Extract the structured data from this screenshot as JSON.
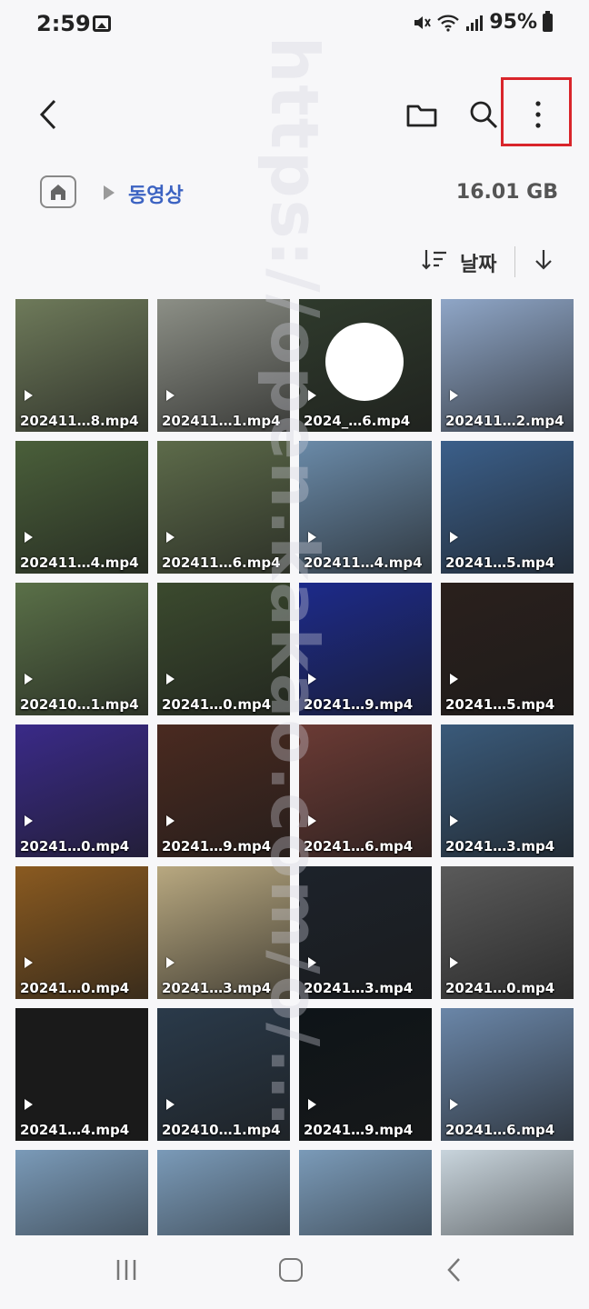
{
  "status_bar": {
    "time": "2:59",
    "battery": "95%"
  },
  "toolbar": {
    "back_icon": "chevron-left-icon",
    "folder_icon": "folder-icon",
    "search_icon": "search-icon",
    "more_icon": "more-vertical-icon"
  },
  "path": {
    "home_icon": "home-icon",
    "current_folder": "동영상",
    "storage_used": "16.01 GB"
  },
  "sort": {
    "label": "날짜"
  },
  "files": [
    {
      "name": "202411…8.mp4",
      "color": "#6e7a5a"
    },
    {
      "name": "202411…1.mp4",
      "color": "#8c8f86"
    },
    {
      "name": "2024_…6.mp4",
      "color": "#2f3a2c"
    },
    {
      "name": "202411…2.mp4",
      "color": "#8fa6c7"
    },
    {
      "name": "202411…4.mp4",
      "color": "#4a5f3a"
    },
    {
      "name": "202411…6.mp4",
      "color": "#5d6b4a"
    },
    {
      "name": "202411…4.mp4",
      "color": "#6a8aa8"
    },
    {
      "name": "20241…5.mp4",
      "color": "#3b5f8a"
    },
    {
      "name": "202410…1.mp4",
      "color": "#5a7048"
    },
    {
      "name": "20241…0.mp4",
      "color": "#3b4a2e"
    },
    {
      "name": "20241…9.mp4",
      "color": "#1c2a8a"
    },
    {
      "name": "20241…5.mp4",
      "color": "#2a201c"
    },
    {
      "name": "20241…0.mp4",
      "color": "#3a2a88"
    },
    {
      "name": "20241…9.mp4",
      "color": "#4a2a20"
    },
    {
      "name": "20241…6.mp4",
      "color": "#6a3a34"
    },
    {
      "name": "20241…3.mp4",
      "color": "#3a5a7a"
    },
    {
      "name": "20241…0.mp4",
      "color": "#8a5a20"
    },
    {
      "name": "20241…3.mp4",
      "color": "#b8a880"
    },
    {
      "name": "20241…3.mp4",
      "color": "#1c222a"
    },
    {
      "name": "20241…0.mp4",
      "color": "#5a5a5a"
    },
    {
      "name": "20241…4.mp4",
      "color": "#1a1a1a"
    },
    {
      "name": "202410…1.mp4",
      "color": "#2a3a4a"
    },
    {
      "name": "20241…9.mp4",
      "color": "#0e1418"
    },
    {
      "name": "20241…6.mp4",
      "color": "#6a86a8"
    },
    {
      "name": "",
      "color": "#7a9ab8"
    },
    {
      "name": "",
      "color": "#7a9ab8"
    },
    {
      "name": "",
      "color": "#7a9ab8"
    },
    {
      "name": "",
      "color": "#c8d4dc"
    }
  ],
  "watermark": "https://open.kakao.com/o/...",
  "navbar": {
    "recents_icon": "recents-icon",
    "home_icon": "home-nav-icon",
    "back_icon": "back-nav-icon"
  }
}
